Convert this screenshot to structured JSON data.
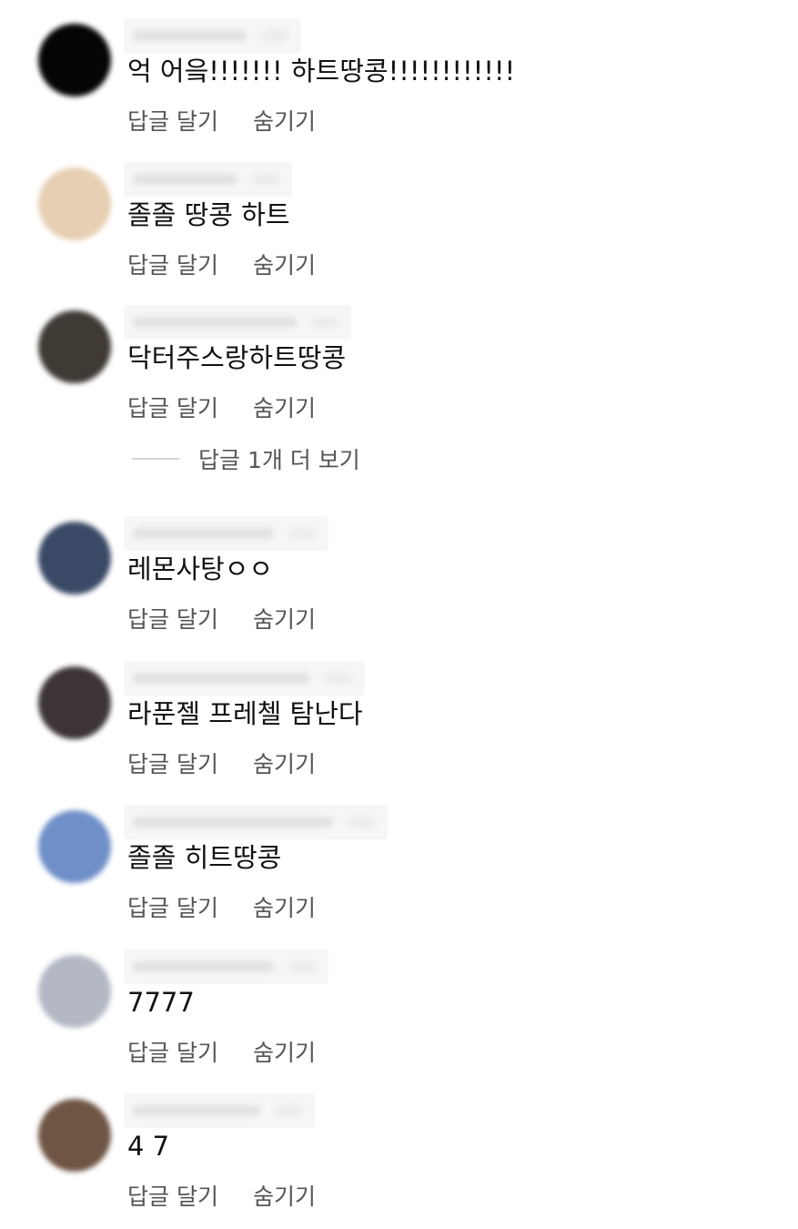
{
  "comments": [
    {
      "text": "억 어읔!!!!!!! 하트땅콩!!!!!!!!!!!!",
      "reply_label": "답글 달기",
      "hide_label": "숨기기",
      "avatar_color": "#050505"
    },
    {
      "text": "졸졸 땅콩 하트",
      "reply_label": "답글 달기",
      "hide_label": "숨기기",
      "avatar_color": "#e6cfb2"
    },
    {
      "text": "닥터주스랑하트땅콩",
      "reply_label": "답글 달기",
      "hide_label": "숨기기",
      "avatar_color": "#3f3a34"
    },
    {
      "text": "레몬사탕ㅇㅇ",
      "reply_label": "답글 달기",
      "hide_label": "숨기기",
      "avatar_color": "#3a4a66"
    },
    {
      "text": "라푼젤 프레첼 탐난다",
      "reply_label": "답글 달기",
      "hide_label": "숨기기",
      "avatar_color": "#3c3438"
    },
    {
      "text": "졸졸 히트땅콩",
      "reply_label": "답글 달기",
      "hide_label": "숨기기",
      "avatar_color": "#6f8fc8"
    },
    {
      "text": "7777",
      "reply_label": "답글 달기",
      "hide_label": "숨기기",
      "avatar_color": "#b3b8c4"
    },
    {
      "text": "4 7",
      "reply_label": "답글 달기",
      "hide_label": "숨기기",
      "avatar_color": "#6e5544"
    }
  ],
  "more_replies": {
    "label": "답글 1개 더 보기"
  }
}
